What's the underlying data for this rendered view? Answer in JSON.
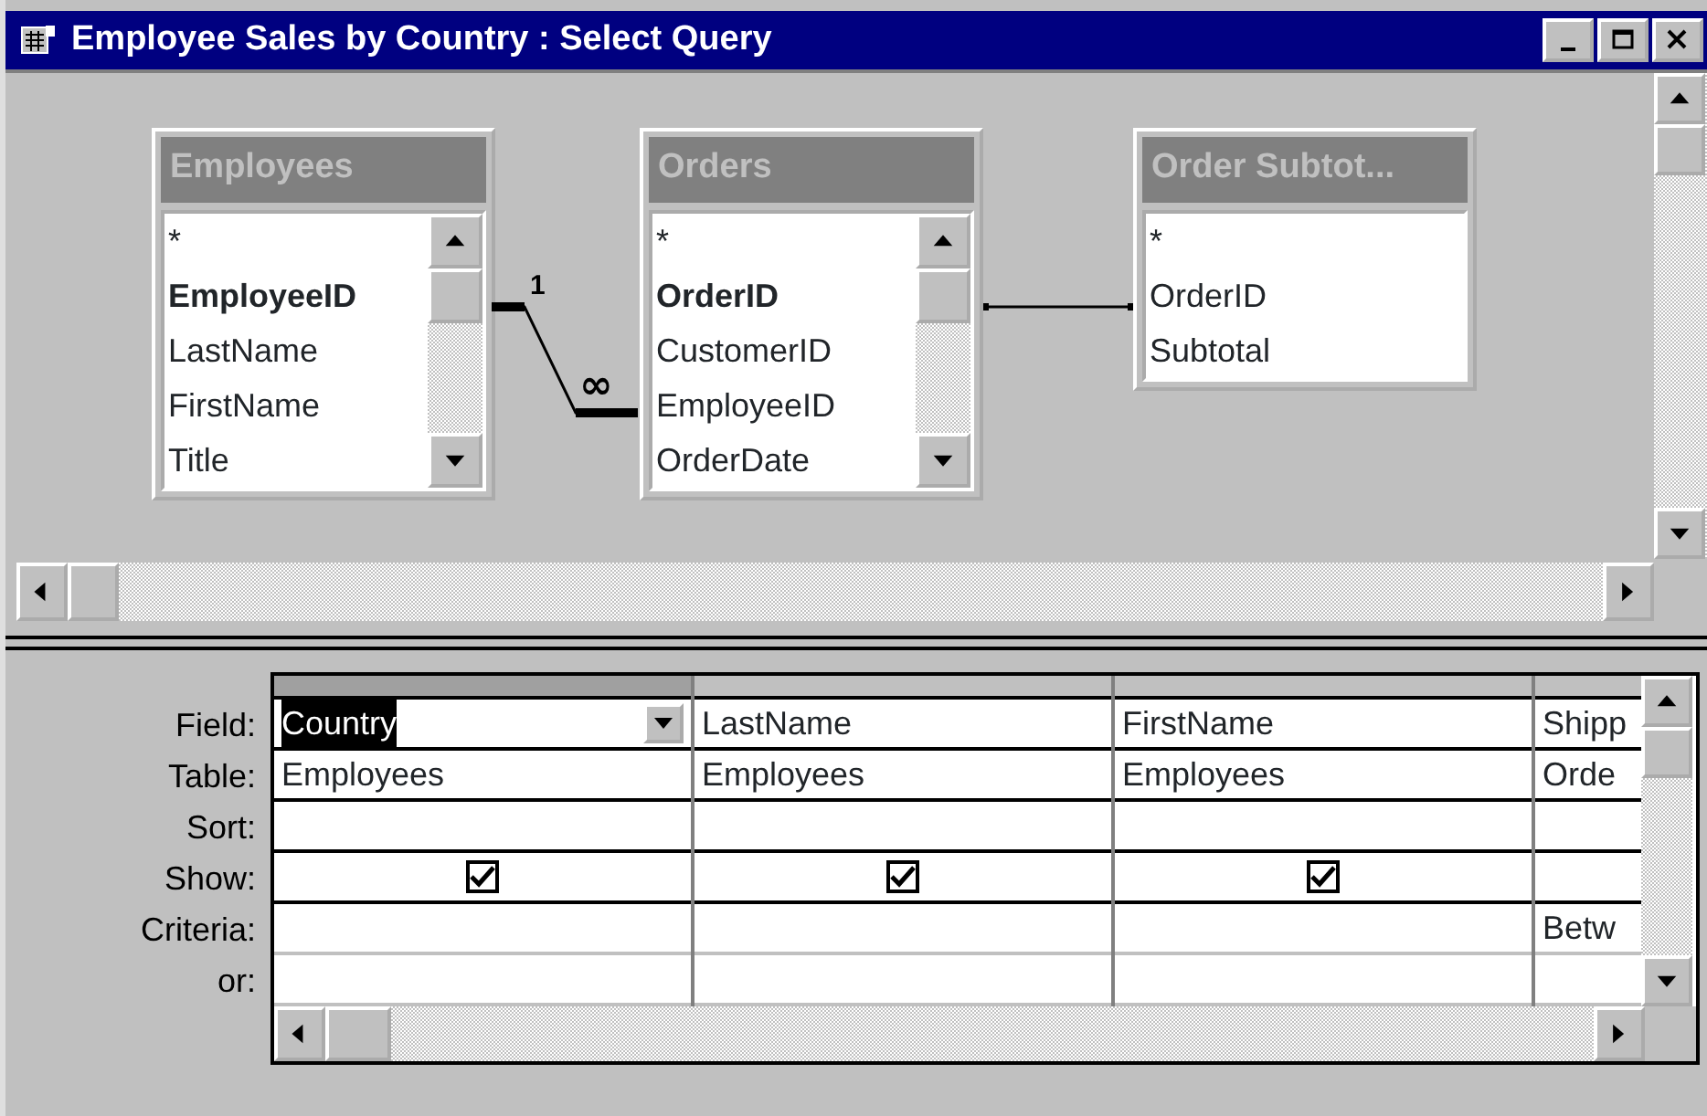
{
  "window": {
    "title": "Employee Sales by Country : Select Query"
  },
  "field_lists": [
    {
      "title": "Employees",
      "scrollable": true,
      "fields": [
        {
          "name": "*",
          "key": false
        },
        {
          "name": "EmployeeID",
          "key": true
        },
        {
          "name": "LastName",
          "key": false
        },
        {
          "name": "FirstName",
          "key": false
        },
        {
          "name": "Title",
          "key": false
        }
      ]
    },
    {
      "title": "Orders",
      "scrollable": true,
      "fields": [
        {
          "name": "*",
          "key": false
        },
        {
          "name": "OrderID",
          "key": true
        },
        {
          "name": "CustomerID",
          "key": false
        },
        {
          "name": "EmployeeID",
          "key": false
        },
        {
          "name": "OrderDate",
          "key": false
        }
      ]
    },
    {
      "title": "Order Subtot...",
      "scrollable": false,
      "fields": [
        {
          "name": "*",
          "key": false
        },
        {
          "name": "OrderID",
          "key": false
        },
        {
          "name": "Subtotal",
          "key": false
        }
      ]
    }
  ],
  "joins": [
    {
      "kind": "one-to-many",
      "one_label": "1",
      "many_label": "∞"
    },
    {
      "kind": "plain"
    }
  ],
  "grid": {
    "row_labels": [
      "Field:",
      "Table:",
      "Sort:",
      "Show:",
      "Criteria:",
      "or:"
    ],
    "columns": [
      {
        "field": "Country",
        "table": "Employees",
        "show": true,
        "selected": true
      },
      {
        "field": "LastName",
        "table": "Employees",
        "show": true,
        "selected": false
      },
      {
        "field": "FirstName",
        "table": "Employees",
        "show": true,
        "selected": false
      },
      {
        "field": "Shipp",
        "table": "Orde",
        "criteria": "Betw",
        "selected": false
      }
    ]
  }
}
